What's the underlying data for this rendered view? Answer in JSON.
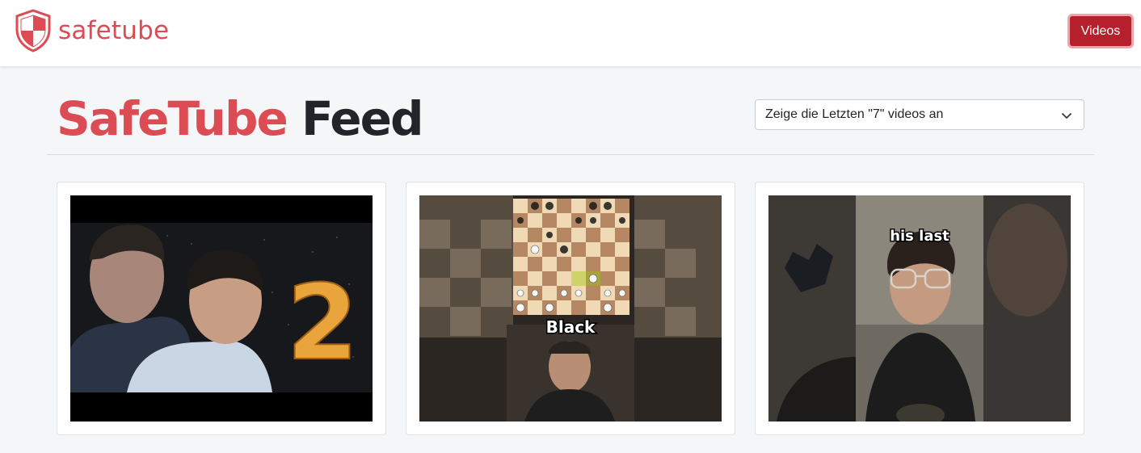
{
  "brand": {
    "name": "safetube",
    "accent_color": "#dc4c55",
    "logo_icon": "shield-icon"
  },
  "nav": {
    "videos_label": "Videos",
    "button_color": "#b5202c"
  },
  "page": {
    "title_accent": "SafeTube",
    "title_rest": "Feed"
  },
  "filter": {
    "selected": "Zeige die Letzten \"7\" videos an",
    "icon": "chevron-down-icon"
  },
  "videos": [
    {
      "thumbnail_text": "2"
    },
    {
      "thumbnail_text": "Black"
    },
    {
      "thumbnail_text": "his last"
    }
  ]
}
